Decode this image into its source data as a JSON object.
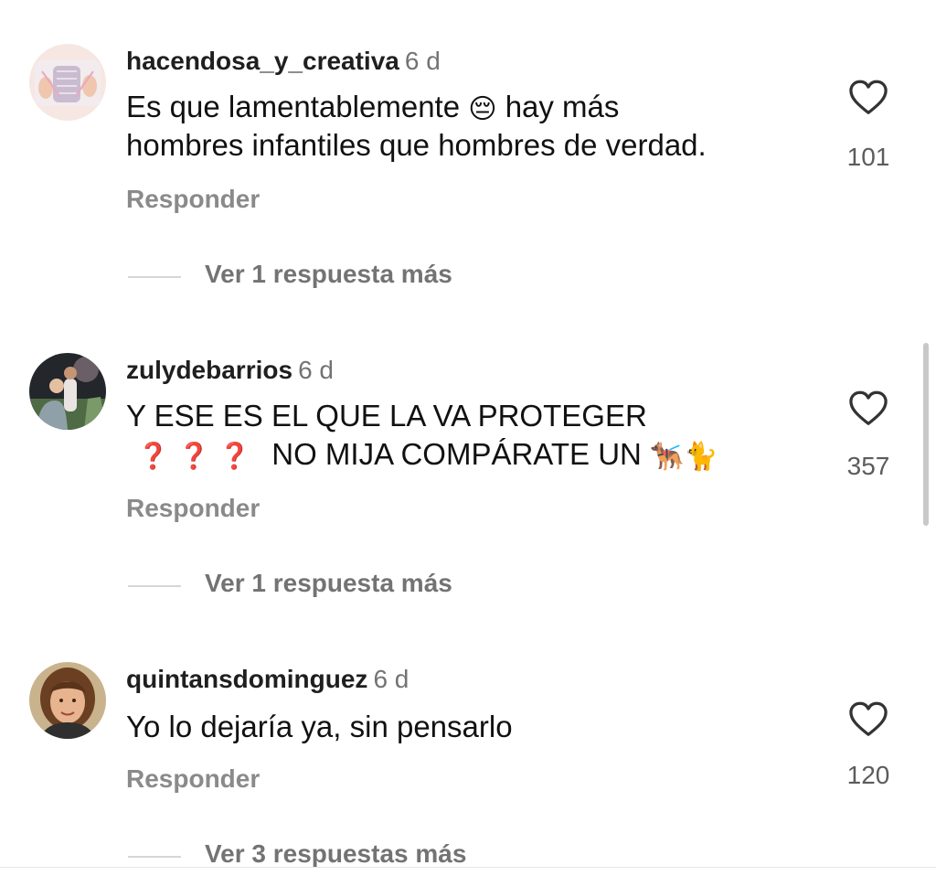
{
  "comments": [
    {
      "username": "hacendosa_y_creativa",
      "time": "6 d",
      "text_line1_a": "Es que lamentablemente",
      "text_line1_emoji": "😔",
      "text_line1_b": "hay más",
      "text_line2": "hombres infantiles que hombres de verdad.",
      "likes": "101",
      "reply_label": "Responder",
      "view_replies": "Ver 1 respuesta más",
      "avatar": "knitting-avatar"
    },
    {
      "username": "zulydebarrios",
      "time": "6 d",
      "text_line1": "Y ESE ES EL QUE LA VA PROTEGER",
      "text_line2_marks": "❓ ❓ ❓",
      "text_line2": "NO MIJA COMPÁRATE UN",
      "text_line2_emoji": "🐕‍🦺🐈",
      "likes": "357",
      "reply_label": "Responder",
      "view_replies": "Ver 1 respuesta más",
      "avatar": "couple-photo-avatar"
    },
    {
      "username": "quintansdominguez",
      "time": "6 d",
      "text_line1": "Yo lo dejaría ya, sin pensarlo",
      "likes": "120",
      "reply_label": "Responder",
      "view_replies": "Ver 3 respuestas más",
      "avatar": "woman-portrait-avatar"
    }
  ],
  "icons": {
    "like": "heart-outline-icon"
  },
  "colors": {
    "username": "#1f1f1f",
    "secondary": "#737373",
    "reply": "#8a8a8a",
    "question_mark": "#e0192b"
  }
}
